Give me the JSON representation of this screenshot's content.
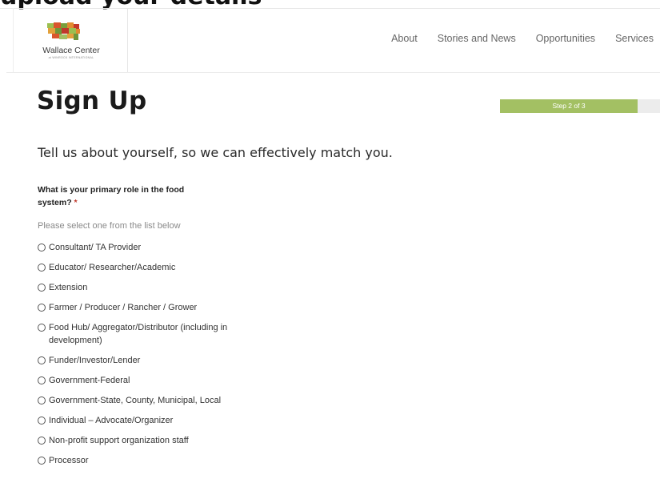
{
  "top_banner": {
    "partial_text": "upload your details"
  },
  "header": {
    "logo": {
      "name": "Wallace Center",
      "sub": "at WINROCK INTERNATIONAL"
    },
    "nav": [
      "About",
      "Stories and News",
      "Opportunities",
      "Services"
    ]
  },
  "page": {
    "title": "Sign Up",
    "progress": {
      "label": "Step 2 of 3",
      "step": 2,
      "total": 3,
      "fill_fraction": 0.86,
      "color": "#a3c063"
    },
    "subtitle": "Tell us about yourself, so we can effectively match you."
  },
  "form": {
    "question": "What is your primary role in the food system?",
    "required_mark": "*",
    "hint": "Please select one from the list below",
    "options": [
      "Consultant/ TA Provider",
      "Educator/ Researcher/Academic",
      "Extension",
      "Farmer / Producer / Rancher / Grower",
      "Food Hub/ Aggregator/Distributor (including in development)",
      "Funder/Investor/Lender",
      "Government-Federal",
      "Government-State, County, Municipal, Local",
      "Individual – Advocate/Organizer",
      "Non-profit support organization staff",
      "Processor"
    ]
  }
}
